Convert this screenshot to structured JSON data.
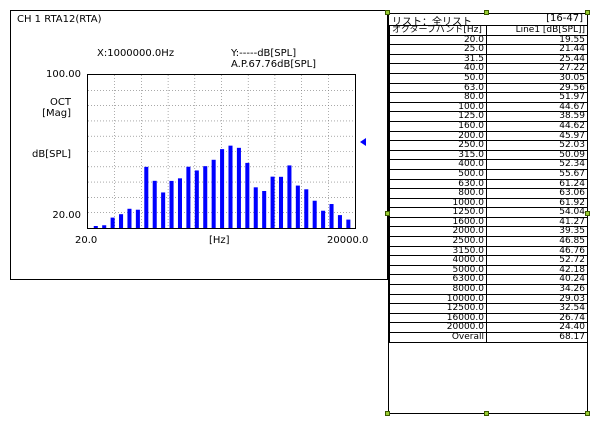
{
  "panel": {
    "title": "CH 1  RTA12(RTA)",
    "readout_x": "X:1000000.0Hz",
    "readout_y": "Y:-----dB[SPL]",
    "readout_ap": "A.P.67.76dB[SPL]",
    "y_top": "100.00",
    "y_oct": "OCT",
    "y_mag": "[Mag]",
    "y_unit": "dB[SPL]",
    "y_bottom": "20.00",
    "x_left": "20.0",
    "x_unit": "[Hz]",
    "x_right": "20000.0"
  },
  "chart_data": {
    "type": "bar",
    "ylim": [
      20,
      100
    ],
    "categories": [
      "20.0",
      "25.0",
      "31.5",
      "40.0",
      "50.0",
      "63.0",
      "80.0",
      "100.0",
      "125.0",
      "160.0",
      "200.0",
      "250.0",
      "315.0",
      "400.0",
      "500.0",
      "630.0",
      "800.0",
      "1000.0",
      "1250.0",
      "1600.0",
      "2000.0",
      "2500.0",
      "3150.0",
      "4000.0",
      "5000.0",
      "6300.0",
      "8000.0",
      "10000.0",
      "12500.0",
      "16000.0",
      "20000.0"
    ],
    "values": [
      19.55,
      21.44,
      25.44,
      27.22,
      30.05,
      29.56,
      51.97,
      44.67,
      38.59,
      44.62,
      45.97,
      52.03,
      50.09,
      52.34,
      55.67,
      61.24,
      63.06,
      61.92,
      54.04,
      41.27,
      39.35,
      46.85,
      46.76,
      52.72,
      42.18,
      40.24,
      34.26,
      29.03,
      32.54,
      26.74,
      24.4
    ],
    "color": "#0000ff"
  },
  "list": {
    "title": "リスト：全リスト",
    "range": "[16-47]",
    "col1_header": "オクターブバンド[Hz]",
    "col2_header": "Line1 [dB[SPL]]",
    "rows": [
      [
        "20.0",
        "19.55"
      ],
      [
        "25.0",
        "21.44"
      ],
      [
        "31.5",
        "25.44"
      ],
      [
        "40.0",
        "27.22"
      ],
      [
        "50.0",
        "30.05"
      ],
      [
        "63.0",
        "29.56"
      ],
      [
        "80.0",
        "51.97"
      ],
      [
        "100.0",
        "44.67"
      ],
      [
        "125.0",
        "38.59"
      ],
      [
        "160.0",
        "44.62"
      ],
      [
        "200.0",
        "45.97"
      ],
      [
        "250.0",
        "52.03"
      ],
      [
        "315.0",
        "50.09"
      ],
      [
        "400.0",
        "52.34"
      ],
      [
        "500.0",
        "55.67"
      ],
      [
        "630.0",
        "61.24"
      ],
      [
        "800.0",
        "63.06"
      ],
      [
        "1000.0",
        "61.92"
      ],
      [
        "1250.0",
        "54.04"
      ],
      [
        "1600.0",
        "41.27"
      ],
      [
        "2000.0",
        "39.35"
      ],
      [
        "2500.0",
        "46.85"
      ],
      [
        "3150.0",
        "46.76"
      ],
      [
        "4000.0",
        "52.72"
      ],
      [
        "5000.0",
        "42.18"
      ],
      [
        "6300.0",
        "40.24"
      ],
      [
        "8000.0",
        "34.26"
      ],
      [
        "10000.0",
        "29.03"
      ],
      [
        "12500.0",
        "32.54"
      ],
      [
        "16000.0",
        "26.74"
      ],
      [
        "20000.0",
        "24.40"
      ],
      [
        "Overall",
        "68.17"
      ]
    ]
  }
}
